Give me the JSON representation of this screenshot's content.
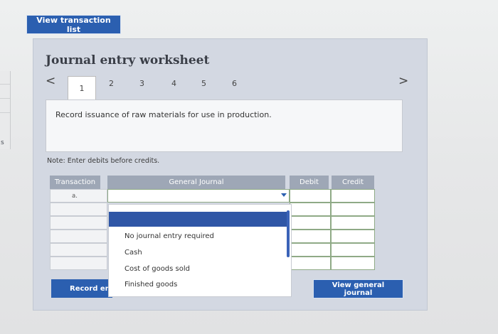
{
  "toolbar": {
    "view_transaction_list": "View transaction list"
  },
  "left_edge": {
    "letter": "s"
  },
  "worksheet": {
    "title": "Journal entry worksheet",
    "nav": {
      "prev": "<",
      "next": ">"
    },
    "pages": [
      "1",
      "2",
      "3",
      "4",
      "5",
      "6"
    ],
    "active_page": "1",
    "description": "Record issuance of raw materials for use in production.",
    "note": "Note: Enter debits before credits."
  },
  "table": {
    "columns": [
      "Transaction",
      "General Journal",
      "Debit",
      "Credit"
    ],
    "first_row_label": "a."
  },
  "dropdown": {
    "options": [
      "",
      "No journal entry required",
      "Cash",
      "Cost of goods sold",
      "Finished goods"
    ]
  },
  "buttons": {
    "record_entry": "Record entry",
    "view_general_journal": "View general journal"
  },
  "colors": {
    "accent": "#2b5fb0",
    "header": "#9ea7b6",
    "panel": "#d3d8e2"
  }
}
